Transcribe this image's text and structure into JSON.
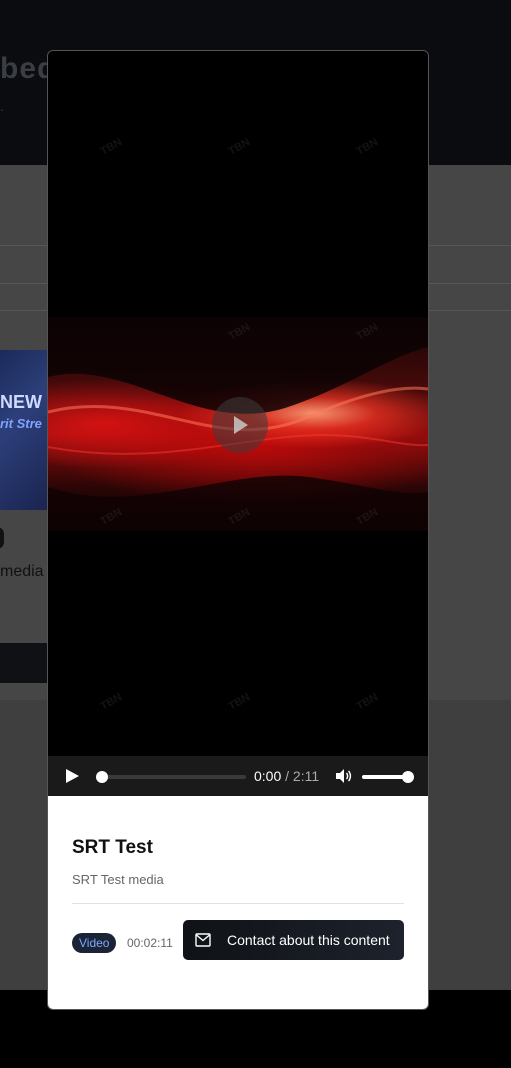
{
  "background": {
    "header_title": "bedt",
    "header_sub": ".",
    "thumb_line1": "NEW",
    "thumb_line2": "rit Stre",
    "media_text": "media"
  },
  "video": {
    "watermark": "TBN",
    "current_time": "0:00",
    "separator": " / ",
    "duration_time": "2:11",
    "progress": 0.0,
    "volume": 1.0
  },
  "content": {
    "title": "SRT Test",
    "subtitle": "SRT Test media",
    "type_badge": "Video",
    "duration": "00:02:11",
    "contact_label": "Contact about this content"
  },
  "colors": {
    "badge_bg": "#1b2436",
    "badge_text": "#7fa8ff",
    "button_bg": "#0f1216"
  }
}
